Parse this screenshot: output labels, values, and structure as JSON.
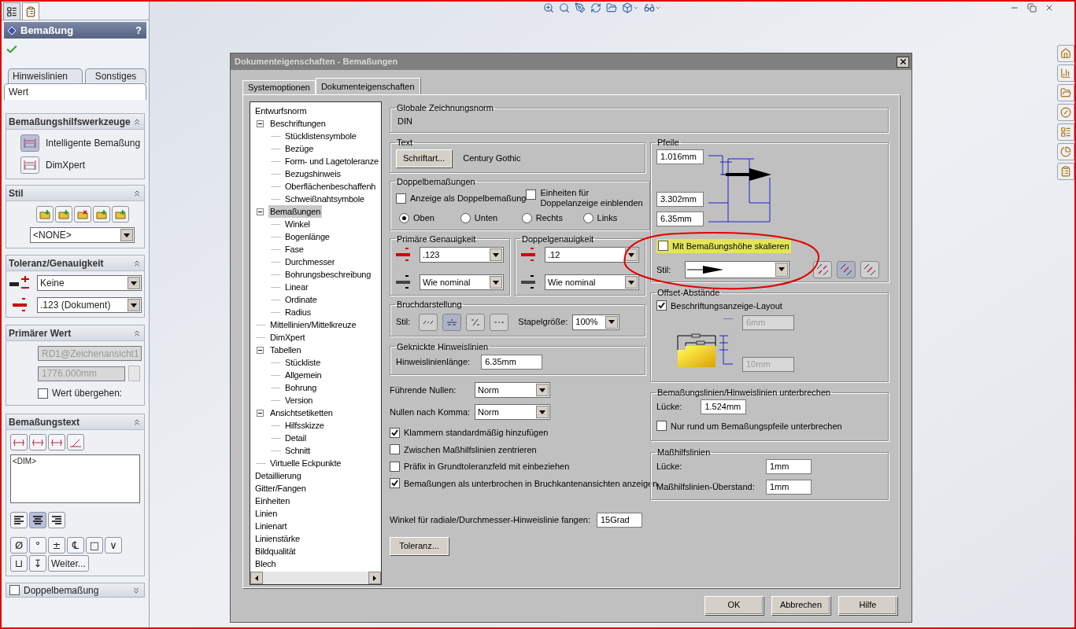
{
  "property_manager": {
    "tabs": [
      {
        "selected": false
      },
      {
        "selected": true
      }
    ],
    "title": "Bemaßung",
    "help": "?",
    "value_tabs": [
      {
        "label": "Hinweislinien",
        "selected": false
      },
      {
        "label": "Sonstiges",
        "selected": false
      },
      {
        "label": "Wert",
        "selected": true
      }
    ],
    "tools": {
      "title": "Bemaßungshilfswerkzeuge",
      "expanded": true,
      "items": [
        {
          "label": "Intelligente Bemaßung",
          "selected": true
        },
        {
          "label": "DimXpert",
          "selected": false
        }
      ]
    },
    "style": {
      "title": "Stil",
      "expanded": true,
      "value": "<NONE>"
    },
    "tolerance": {
      "title": "Toleranz/Genauigkeit",
      "expanded": true,
      "tolerance": "Keine",
      "precision": ".123 (Dokument)"
    },
    "primary_value": {
      "title": "Primärer Wert",
      "expanded": true,
      "reference": "RD1@Zeichenansicht1",
      "value": "1776.000mm",
      "disabled": true,
      "override": {
        "label": "Wert übergehen:",
        "checked": false
      }
    },
    "dimension_text": {
      "title": "Bemaßungstext",
      "expanded": true,
      "text": "<DIM>",
      "alignment": [
        {
          "selected": false
        },
        {
          "selected": true
        },
        {
          "selected": false
        }
      ],
      "symbols": [
        "Ø",
        "°",
        "±",
        "℄",
        "□",
        "∨",
        "⊔",
        "↧"
      ],
      "more": "Weiter..."
    },
    "dual": {
      "title": "Doppelbemaßung",
      "checked": false,
      "expanded": false
    }
  },
  "dialog": {
    "title": "Dokumenteigenschaften - Bemaßungen",
    "tabs": [
      {
        "label": "Systemoptionen",
        "selected": false
      },
      {
        "label": "Dokumenteigenschaften",
        "selected": true
      }
    ],
    "tree": [
      {
        "label": "Entwurfsnorm",
        "selected": false,
        "children": [
          {
            "label": "Beschriftungen",
            "selected": false,
            "expanded": true,
            "children": [
              {
                "label": "Stücklistensymbole",
                "selected": false
              },
              {
                "label": "Bezüge",
                "selected": false
              },
              {
                "label": "Form- und Lagetoleranze",
                "selected": false
              },
              {
                "label": "Bezugshinweis",
                "selected": false
              },
              {
                "label": "Oberflächenbeschaffenh",
                "selected": false
              },
              {
                "label": "Schweißnahtsymbole",
                "selected": false
              }
            ]
          },
          {
            "label": "Bemaßungen",
            "selected": true,
            "expanded": true,
            "children": [
              {
                "label": "Winkel",
                "selected": false
              },
              {
                "label": "Bogenlänge",
                "selected": false
              },
              {
                "label": "Fase",
                "selected": false
              },
              {
                "label": "Durchmesser",
                "selected": false
              },
              {
                "label": "Bohrungsbeschreibung",
                "selected": false
              },
              {
                "label": "Linear",
                "selected": false
              },
              {
                "label": "Ordinate",
                "selected": false
              },
              {
                "label": "Radius",
                "selected": false
              }
            ]
          },
          {
            "label": "Mittellinien/Mittelkreuze",
            "selected": false
          },
          {
            "label": "DimXpert",
            "selected": false
          },
          {
            "label": "Tabellen",
            "selected": false,
            "expanded": true,
            "children": [
              {
                "label": "Stückliste",
                "selected": false
              },
              {
                "label": "Allgemein",
                "selected": false
              },
              {
                "label": "Bohrung",
                "selected": false
              },
              {
                "label": "Version",
                "selected": false
              }
            ]
          },
          {
            "label": "Ansichtsetiketten",
            "selected": false,
            "expanded": true,
            "children": [
              {
                "label": "Hilfsskizze",
                "selected": false
              },
              {
                "label": "Detail",
                "selected": false
              },
              {
                "label": "Schnitt",
                "selected": false
              }
            ]
          },
          {
            "label": "Virtuelle Eckpunkte",
            "selected": false
          }
        ]
      },
      {
        "label": "Detaillierung",
        "selected": false
      },
      {
        "label": "Gitter/Fangen",
        "selected": false
      },
      {
        "label": "Einheiten",
        "selected": false
      },
      {
        "label": "Linien",
        "selected": false
      },
      {
        "label": "Linienart",
        "selected": false
      },
      {
        "label": "Linienstärke",
        "selected": false
      },
      {
        "label": "Bildqualität",
        "selected": false
      },
      {
        "label": "Blech",
        "selected": false
      }
    ],
    "global_standard": {
      "title": "Globale Zeichnungsnorm",
      "value": "DIN"
    },
    "text": {
      "title": "Text",
      "button": "Schriftart...",
      "font": "Century Gothic"
    },
    "dual": {
      "title": "Doppelbemaßungen",
      "options": [
        {
          "label": "Anzeige als Doppelbemaßung",
          "checked": false
        },
        {
          "label": "Einheiten für Doppelanzeige einblenden",
          "checked": false
        }
      ],
      "positions": [
        {
          "label": "Oben",
          "selected": true
        },
        {
          "label": "Unten",
          "selected": false
        },
        {
          "label": "Rechts",
          "selected": false
        },
        {
          "label": "Links",
          "selected": false
        }
      ]
    },
    "precision": [
      {
        "title": "Primäre Genauigkeit",
        "value": ".123",
        "tolerance": "Wie nominal"
      },
      {
        "title": "Doppelgenauigkeit",
        "value": ".12",
        "tolerance": "Wie nominal"
      }
    ],
    "fraction": {
      "title": "Bruchdarstellung",
      "style_label": "Stil:",
      "styles": [
        {
          "selected": false
        },
        {
          "selected": true
        },
        {
          "selected": false
        },
        {
          "selected": false
        }
      ],
      "stack_label": "Stapelgröße:",
      "stack": "100%"
    },
    "bent_leaders": {
      "title": "Geknickte Hinweislinien",
      "label": "Hinweislinienlänge:",
      "value": "6.35mm"
    },
    "zeros": [
      {
        "label": "Führende Nullen:",
        "value": "Norm"
      },
      {
        "label": "Nullen nach Komma:",
        "value": "Norm"
      }
    ],
    "options": [
      {
        "label": "Klammern standardmäßig hinzufügen",
        "checked": true
      },
      {
        "label": "Zwischen Maßhilfslinien zentrieren",
        "checked": false
      },
      {
        "label": "Präfix in Grundtoleranzfeld mit einbeziehen",
        "checked": false
      },
      {
        "label": "Bemaßungen als unterbrochen in Bruchkantenansichten anzeigen",
        "checked": true
      }
    ],
    "snap": {
      "label": "Winkel für radiale/Durchmesser-Hinweislinie fangen:",
      "value": "15Grad"
    },
    "tolerance_button": "Toleranz...",
    "arrows": {
      "title": "Pfeile",
      "height": "1.016mm",
      "width": "3.302mm",
      "length": "6.35mm",
      "scale": {
        "label": "Mit Bemaßungshöhe skalieren",
        "checked": false
      },
      "style_label": "Stil:",
      "placements": [
        {
          "selected": false
        },
        {
          "selected": true
        },
        {
          "selected": false
        }
      ]
    },
    "offsets": {
      "title": "Offset-Abstände",
      "layout": {
        "label": "Beschriftungsanzeige-Layout",
        "checked": true
      },
      "top": "6mm",
      "bottom": "10mm",
      "disabled": true
    },
    "break": {
      "title": "Bemaßungslinien/Hinweislinien unterbrechen",
      "gap_label": "Lücke:",
      "gap": "1.524mm",
      "only_arrows": {
        "label": "Nur rund um Bemaßungspfeile unterbrechen",
        "checked": false
      }
    },
    "extension": {
      "title": "Maßhilfslinien",
      "rows": [
        {
          "label": "Lücke:",
          "value": "1mm"
        },
        {
          "label": "Maßhilfslinien-Überstand:",
          "value": "1mm"
        }
      ]
    },
    "buttons": [
      "OK",
      "Abbrechen",
      "Hilfe"
    ]
  }
}
